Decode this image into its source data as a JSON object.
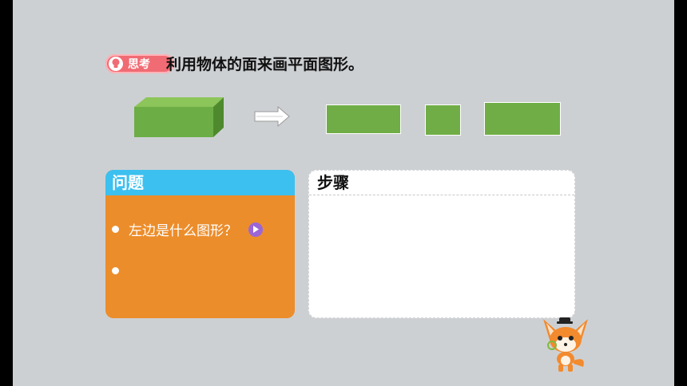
{
  "header": {
    "badge_label": "思考",
    "badge_icon": "lightbulb-icon",
    "title": "利用物体的面来画平面图形。"
  },
  "illustration": {
    "solid_color": "#70ad47",
    "arrow_icon": "right-arrow-icon"
  },
  "questions_panel": {
    "title": "问题",
    "items": [
      {
        "text": "左边是什么图形？",
        "has_play": true
      },
      {
        "text": "",
        "has_play": false
      }
    ],
    "header_color": "#3cc0ef",
    "body_color": "#ec8d2b"
  },
  "steps_panel": {
    "title": "步骤"
  },
  "colors": {
    "background": "#cdd0d3",
    "badge": "#f06b73",
    "play_button": "#9b66d6"
  }
}
